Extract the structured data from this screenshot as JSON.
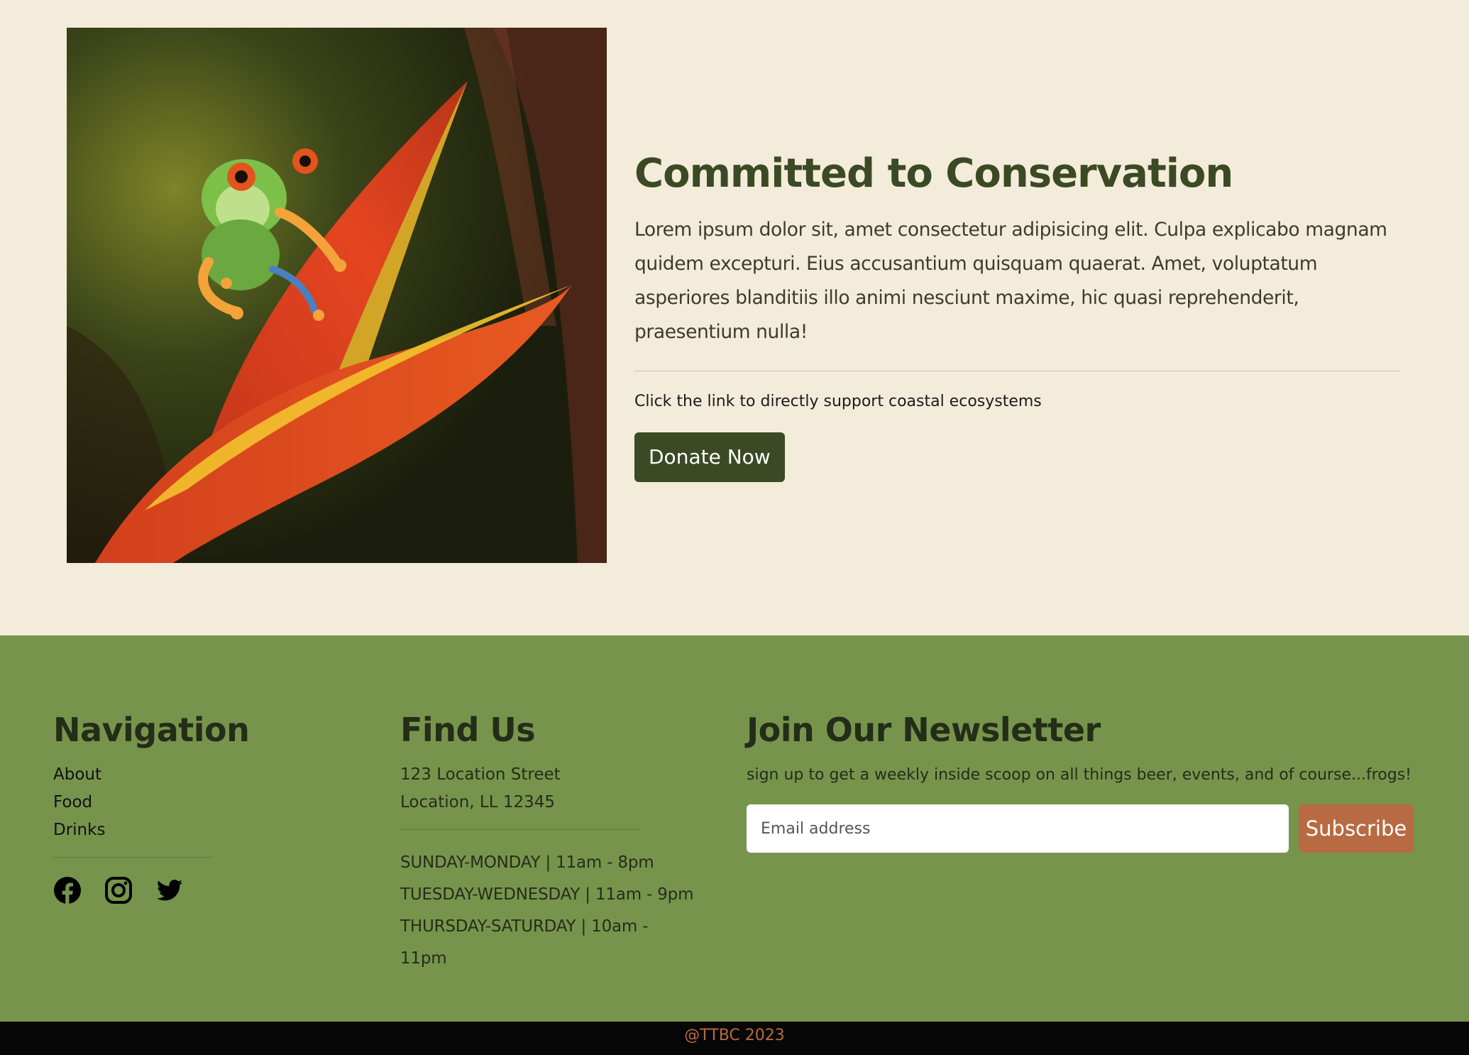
{
  "conservation": {
    "image_alt": "Red-eyed tree frog on a red heliconia flower",
    "title": "Committed to Conservation",
    "body": "Lorem ipsum dolor sit, amet consectetur adipisicing elit. Culpa explicabo magnam quidem excepturi. Eius accusantium quisquam quaerat. Amet, voluptatum asperiores blanditiis illo animi nesciunt maxime, hic quasi reprehenderit, praesentium nulla!",
    "cta_text": "Click the link to directly support coastal ecosystems",
    "donate_label": "Donate Now"
  },
  "footer": {
    "navigation": {
      "heading": "Navigation",
      "links": [
        "About",
        "Food",
        "Drinks"
      ],
      "social_icons": [
        "facebook-icon",
        "instagram-icon",
        "twitter-icon"
      ]
    },
    "find_us": {
      "heading": "Find Us",
      "address_line1": "123 Location Street",
      "address_line2": "Location, LL 12345",
      "hours": [
        "SUNDAY-MONDAY | 11am - 8pm",
        "TUESDAY-WEDNESDAY | 11am - 9pm",
        "THURSDAY-SATURDAY | 10am - 11pm"
      ]
    },
    "newsletter": {
      "heading": "Join Our Newsletter",
      "text": "sign up to get a weekly inside scoop on all things beer, events, and of course...frogs!",
      "email_placeholder": "Email address",
      "subscribe_label": "Subscribe"
    }
  },
  "copyright": "@TTBC 2023",
  "colors": {
    "page_background": "#f4ecdb",
    "primary_green": "#3b4a24",
    "footer_green": "#77944d",
    "accent_orange": "#b86a42",
    "bottom_bar": "#070707"
  }
}
